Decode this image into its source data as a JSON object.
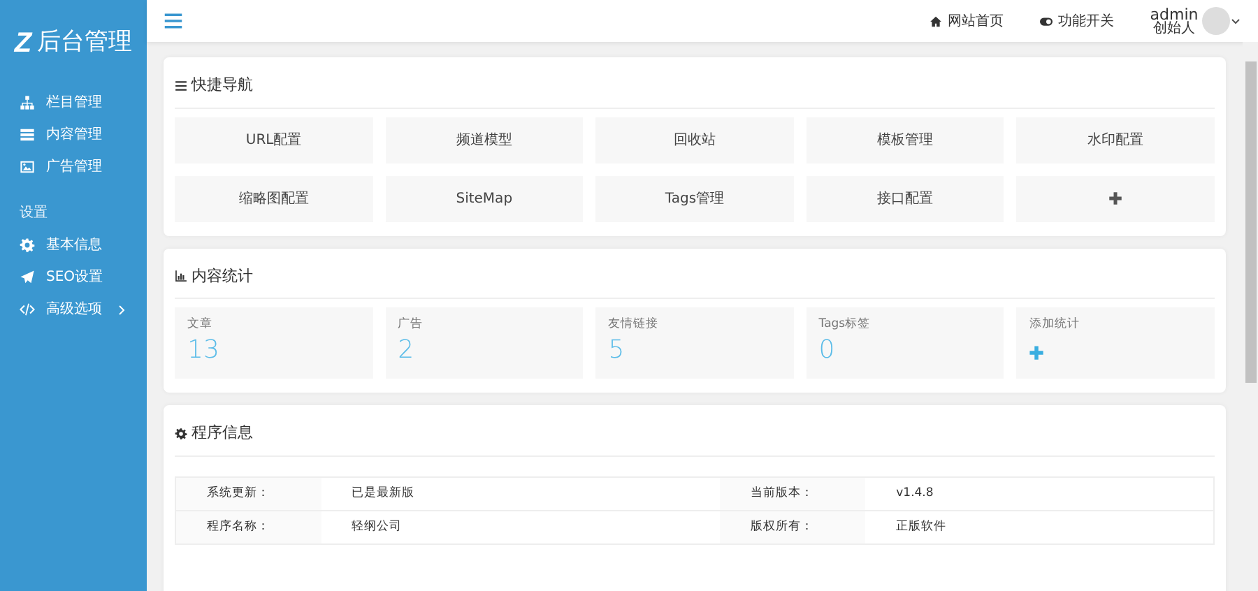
{
  "sidebar": {
    "logo_mark": "Z",
    "logo_text": "后台管理",
    "items": [
      {
        "kind": "item",
        "label": "栏目管理",
        "selected": false
      },
      {
        "kind": "item",
        "label": "内容管理",
        "selected": false
      },
      {
        "kind": "item",
        "label": "广告管理",
        "selected": false
      },
      {
        "kind": "heading",
        "label": "设置"
      },
      {
        "kind": "item",
        "label": "基本信息",
        "selected": false
      },
      {
        "kind": "item",
        "label": "SEO设置",
        "selected": false
      },
      {
        "kind": "item",
        "label": "高级选项",
        "selected": false,
        "expandable": true
      }
    ]
  },
  "topbar": {
    "links": [
      {
        "label": "网站首页"
      },
      {
        "label": "功能开关"
      }
    ],
    "user": {
      "name": "admin",
      "role": "创始人"
    }
  },
  "quick_nav": {
    "title": "快捷导航",
    "items": [
      {
        "kind": "text",
        "label": "URL配置"
      },
      {
        "kind": "text",
        "label": "频道模型"
      },
      {
        "kind": "text",
        "label": "回收站"
      },
      {
        "kind": "text",
        "label": "模板管理"
      },
      {
        "kind": "text",
        "label": "水印配置"
      },
      {
        "kind": "text",
        "label": "缩略图配置"
      },
      {
        "kind": "text",
        "label": "SiteMap"
      },
      {
        "kind": "text",
        "label": "Tags管理"
      },
      {
        "kind": "text",
        "label": "接口配置"
      },
      {
        "kind": "add"
      }
    ]
  },
  "stats": {
    "title": "内容统计",
    "items": [
      {
        "kind": "count",
        "label": "文章",
        "value": "13"
      },
      {
        "kind": "count",
        "label": "广告",
        "value": "2"
      },
      {
        "kind": "count",
        "label": "友情链接",
        "value": "5"
      },
      {
        "kind": "count",
        "label": "Tags标签",
        "value": "0"
      },
      {
        "kind": "add",
        "label": "添加统计"
      }
    ]
  },
  "program_info": {
    "title": "程序信息",
    "rows": [
      {
        "label_1": "系统更新：",
        "value_1": "已是最新版",
        "label_2": "当前版本：",
        "value_2": "v1.4.8"
      },
      {
        "label_1": "程序名称：",
        "value_1": "轻纲公司",
        "label_2": "版权所有：",
        "value_2": "正版软件"
      }
    ]
  }
}
